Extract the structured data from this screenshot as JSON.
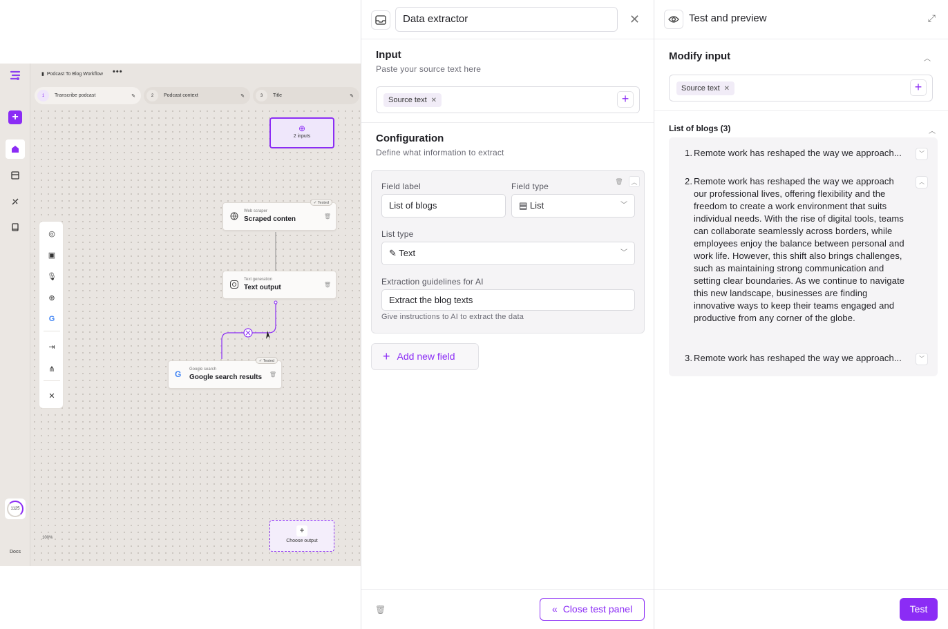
{
  "workflow": {
    "title": "Podcast To Blog Workflow",
    "more_label": "•••",
    "steps": [
      {
        "num": "1",
        "label": "Transcribe podcast"
      },
      {
        "num": "2",
        "label": "Podcast context"
      },
      {
        "num": "3",
        "label": "Title"
      }
    ],
    "inputs_node_label": "2 inputs",
    "nodes": {
      "web_scraper": {
        "type": "Web scraper",
        "name": "Scraped conten",
        "badge": "✓ Tested"
      },
      "text_generation": {
        "type": "Text generation",
        "name": "Text output"
      },
      "google_search": {
        "type": "Google search",
        "name": "Google search results",
        "badge": "✓ Tested"
      }
    },
    "output_node_label": "Choose output",
    "zoom": "100%",
    "credits": "1125",
    "docs_label": "Docs"
  },
  "extractor": {
    "title": "Data extractor",
    "input": {
      "heading": "Input",
      "subheading": "Paste your source text here",
      "chip": "Source text"
    },
    "configuration": {
      "heading": "Configuration",
      "subheading": "Define what information to extract"
    },
    "field": {
      "field_label_label": "Field label",
      "field_label_value": "List of blogs",
      "field_type_label": "Field type",
      "field_type_value": "List",
      "list_type_label": "List type",
      "list_type_value": "Text",
      "guidelines_label": "Extraction guidelines for AI",
      "guidelines_value": "Extract the blog texts",
      "guidelines_hint": "Give instructions to AI to extract the data"
    },
    "add_field_label": "Add new field",
    "close_test_label": "Close test panel"
  },
  "preview": {
    "title": "Test and preview",
    "modify_heading": "Modify input",
    "chip": "Source text",
    "results_heading": "List of blogs (3)",
    "results": [
      {
        "num": "1.",
        "text": "Remote work has reshaped the way we approach..."
      },
      {
        "num": "2.",
        "text": "Remote work has reshaped the way we approach our professional lives, offering flexibility and the freedom to create a work environment that suits individual needs. With the rise of digital tools, teams can collaborate seamlessly across borders, while employees enjoy the balance between personal and work life. However, this shift also brings challenges, such as maintaining strong communication and setting clear boundaries. As we continue to navigate this new landscape, businesses are finding innovative ways to keep their teams engaged and productive from any corner of the globe."
      },
      {
        "num": "3.",
        "text": "Remote work has reshaped the way we approach..."
      }
    ],
    "test_label": "Test"
  },
  "colors": {
    "accent": "#8b2cf5",
    "canvas_bg": "#e9e5e1",
    "chip_bg": "#f1ecf7"
  }
}
